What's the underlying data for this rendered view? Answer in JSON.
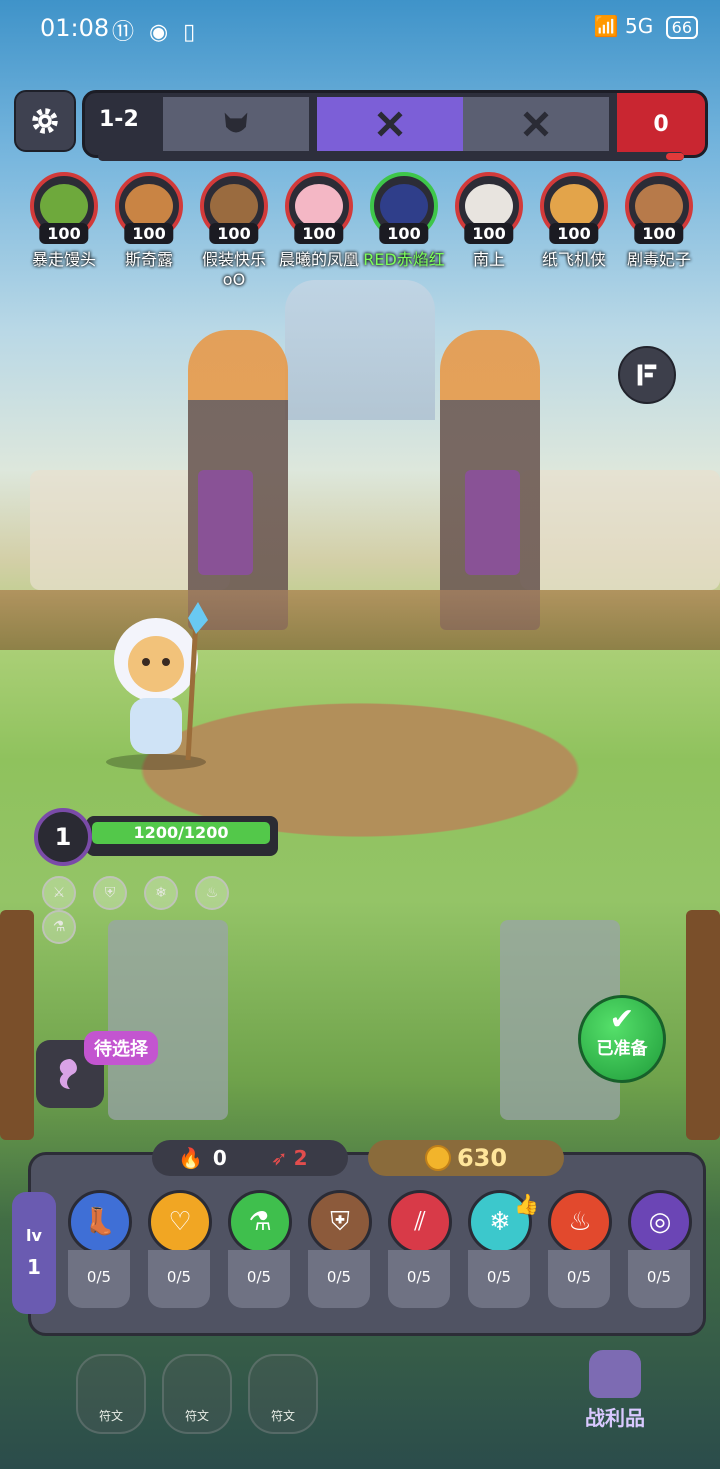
{
  "status_bar": {
    "time": "01:08",
    "icons_left": "⑪ ◉ ▯",
    "network": "5G",
    "battery": "66"
  },
  "stage": {
    "label": "1-2",
    "enemy_count": "0",
    "segments": [
      "boss-face-icon",
      "swords-icon",
      "swords-icon"
    ]
  },
  "players": [
    {
      "name": "暴走馒头",
      "hp": "100",
      "face_color": "#6ea93c",
      "ready": false
    },
    {
      "name": "斯奇露",
      "hp": "100",
      "face_color": "#c98444",
      "ready": false
    },
    {
      "name": "假装快乐oO",
      "hp": "100",
      "face_color": "#9a6b3f",
      "ready": false
    },
    {
      "name": "晨曦的凤凰",
      "hp": "100",
      "face_color": "#f4b7c5",
      "ready": false
    },
    {
      "name": "RED赤焰红",
      "hp": "100",
      "face_color": "#2f3e8a",
      "ready": true
    },
    {
      "name": "南上",
      "hp": "100",
      "face_color": "#e8e4df",
      "ready": false
    },
    {
      "name": "纸飞机侠",
      "hp": "100",
      "face_color": "#e3a44a",
      "ready": false
    },
    {
      "name": "剧毒妃子",
      "hp": "100",
      "face_color": "#b77a4a",
      "ready": false
    }
  ],
  "hero": {
    "level": "1",
    "hp_text": "1200/1200",
    "hp_fraction": 1.0
  },
  "buff_icons": [
    "sword-icon",
    "shield-icon",
    "snowflake-icon",
    "flame-icon",
    "potion-icon"
  ],
  "pending": {
    "label": "待选择"
  },
  "ready_button": {
    "label": "已准备"
  },
  "resources": {
    "fire": "0",
    "arrows": "2",
    "gold": "630"
  },
  "skills_panel": {
    "lv_label": "lv",
    "lv_value": "1",
    "skills": [
      {
        "icon": "boot-icon",
        "progress": "0/5",
        "color": "#3f6fd6",
        "glyph": "👢"
      },
      {
        "icon": "heart-icon",
        "progress": "0/5",
        "color": "#f1a623",
        "glyph": "♡"
      },
      {
        "icon": "potion-icon",
        "progress": "0/5",
        "color": "#3fbf4d",
        "glyph": "⚗"
      },
      {
        "icon": "shield-icon",
        "progress": "0/5",
        "color": "#8c5a3b",
        "glyph": "⛨"
      },
      {
        "icon": "claw-icon",
        "progress": "0/5",
        "color": "#d83a48",
        "glyph": "⫽"
      },
      {
        "icon": "snowflake-icon",
        "progress": "0/5",
        "color": "#3cc8cc",
        "glyph": "❄"
      },
      {
        "icon": "flame-icon",
        "progress": "0/5",
        "color": "#e2492d",
        "glyph": "🔥"
      },
      {
        "icon": "vortex-icon",
        "progress": "0/5",
        "color": "#6b45b5",
        "glyph": "◎"
      }
    ]
  },
  "runes": [
    "符文",
    "符文",
    "符文"
  ],
  "loot": {
    "label": "战利品"
  }
}
